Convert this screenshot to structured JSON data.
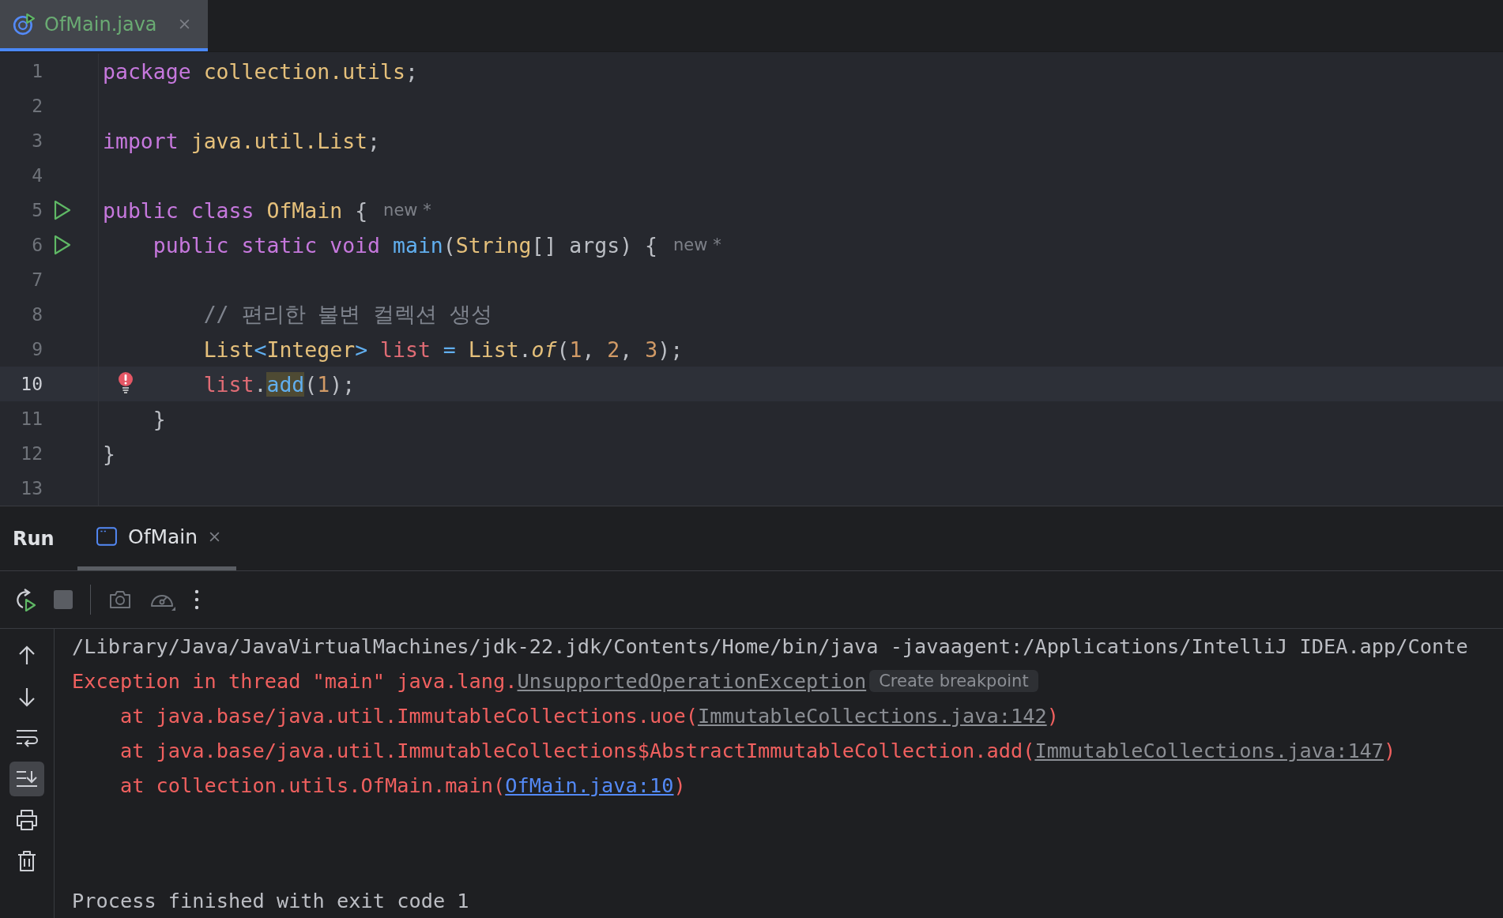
{
  "editor_tabs": [
    {
      "label": "OfMain.java",
      "selected": true
    }
  ],
  "code_lines": [
    {
      "number": "1",
      "run": false,
      "error": false,
      "current": false,
      "tokens": [
        {
          "text": "package ",
          "kind": "keyword"
        },
        {
          "text": "collection.utils",
          "kind": "type"
        },
        {
          "text": ";",
          "kind": "plain"
        }
      ]
    },
    {
      "number": "2",
      "run": false,
      "error": false,
      "current": false
    },
    {
      "number": "3",
      "run": false,
      "error": false,
      "current": false,
      "tokens": [
        {
          "text": "import ",
          "kind": "keyword"
        },
        {
          "text": "java.util.List",
          "kind": "type"
        },
        {
          "text": ";",
          "kind": "plain"
        }
      ]
    },
    {
      "number": "4",
      "run": false,
      "error": false,
      "current": false
    },
    {
      "number": "5",
      "run": true,
      "error": false,
      "current": false,
      "tokens": [
        {
          "text": "public class ",
          "kind": "keyword"
        },
        {
          "text": "OfMain",
          "kind": "type"
        },
        {
          "text": " {",
          "kind": "plain"
        },
        {
          "text": "new *",
          "kind": "hint"
        }
      ]
    },
    {
      "number": "6",
      "run": true,
      "error": false,
      "current": false,
      "tokens": [
        {
          "text": "    public static void ",
          "kind": "keyword"
        },
        {
          "text": "main",
          "kind": "method"
        },
        {
          "text": "(",
          "kind": "plain"
        },
        {
          "text": "String",
          "kind": "type"
        },
        {
          "text": "[] args) {",
          "kind": "plain"
        },
        {
          "text": "new *",
          "kind": "hint"
        }
      ]
    },
    {
      "number": "7",
      "run": false,
      "error": false,
      "current": false
    },
    {
      "number": "8",
      "run": false,
      "error": false,
      "current": false,
      "tokens": [
        {
          "text": "        // 편리한 불변 컬렉션 생성",
          "kind": "comment"
        }
      ]
    },
    {
      "number": "9",
      "run": false,
      "error": false,
      "current": false,
      "tokens": [
        {
          "text": "        List",
          "kind": "type"
        },
        {
          "text": "<",
          "kind": "operator"
        },
        {
          "text": "Integer",
          "kind": "type"
        },
        {
          "text": "> ",
          "kind": "operator"
        },
        {
          "text": "list",
          "kind": "variable"
        },
        {
          "text": " = ",
          "kind": "operator"
        },
        {
          "text": "List",
          "kind": "type"
        },
        {
          "text": ".",
          "kind": "plain"
        },
        {
          "text": "of",
          "kind": "static"
        },
        {
          "text": "(",
          "kind": "plain"
        },
        {
          "text": "1",
          "kind": "number"
        },
        {
          "text": ", ",
          "kind": "plain"
        },
        {
          "text": "2",
          "kind": "number"
        },
        {
          "text": ", ",
          "kind": "plain"
        },
        {
          "text": "3",
          "kind": "number"
        },
        {
          "text": ");",
          "kind": "plain"
        }
      ]
    },
    {
      "number": "10",
      "run": false,
      "error": true,
      "current": true,
      "tokens": [
        {
          "text": "        list",
          "kind": "variable"
        },
        {
          "text": ".",
          "kind": "plain"
        },
        {
          "text": "add",
          "kind": "marked"
        },
        {
          "text": "(",
          "kind": "plain"
        },
        {
          "text": "1",
          "kind": "number"
        },
        {
          "text": ");",
          "kind": "plain"
        }
      ]
    },
    {
      "number": "11",
      "run": false,
      "error": false,
      "current": false,
      "tokens": [
        {
          "text": "    }",
          "kind": "plain"
        }
      ]
    },
    {
      "number": "12",
      "run": false,
      "error": false,
      "current": false,
      "tokens": [
        {
          "text": "}",
          "kind": "plain"
        }
      ]
    },
    {
      "number": "13",
      "run": false,
      "error": false,
      "current": false
    }
  ],
  "run_panel": {
    "title": "Run",
    "tabs": [
      {
        "label": "OfMain",
        "selected": true
      }
    ]
  },
  "console_tools": [
    {
      "on": false
    },
    {
      "on": false
    },
    {
      "on": false
    },
    {
      "on": true
    },
    {
      "on": false
    },
    {
      "on": false
    }
  ],
  "console_lines": [
    {
      "spans": [
        {
          "text": "/Library/Java/JavaVirtualMachines/jdk-22.jdk/Contents/Home/bin/java -javaagent:/Applications/IntelliJ IDEA.app/Conte",
          "kind": "normal"
        }
      ]
    },
    {
      "spans": [
        {
          "text": "Exception in thread \"main\" java.lang.",
          "kind": "error"
        },
        {
          "text": "UnsupportedOperationException",
          "kind": "link"
        },
        {
          "text": "Create breakpoint",
          "kind": "hint"
        }
      ]
    },
    {
      "spans": [
        {
          "text": "    at java.base/java.util.ImmutableCollections.uoe(",
          "kind": "error"
        },
        {
          "text": "ImmutableCollections.java:142",
          "kind": "link"
        },
        {
          "text": ")",
          "kind": "error"
        }
      ]
    },
    {
      "spans": [
        {
          "text": "    at java.base/java.util.ImmutableCollections$AbstractImmutableCollection.add(",
          "kind": "error"
        },
        {
          "text": "ImmutableCollections.java:147",
          "kind": "link"
        },
        {
          "text": ")",
          "kind": "error"
        }
      ]
    },
    {
      "spans": [
        {
          "text": "    at collection.utils.OfMain.main(",
          "kind": "error"
        },
        {
          "text": "OfMain.java:10",
          "kind": "source-link"
        },
        {
          "text": ")",
          "kind": "error"
        }
      ]
    }
  ],
  "exit_lines": [
    {
      "spans": [
        {
          "text": "Process finished with exit code 1",
          "kind": "normal"
        }
      ]
    }
  ]
}
